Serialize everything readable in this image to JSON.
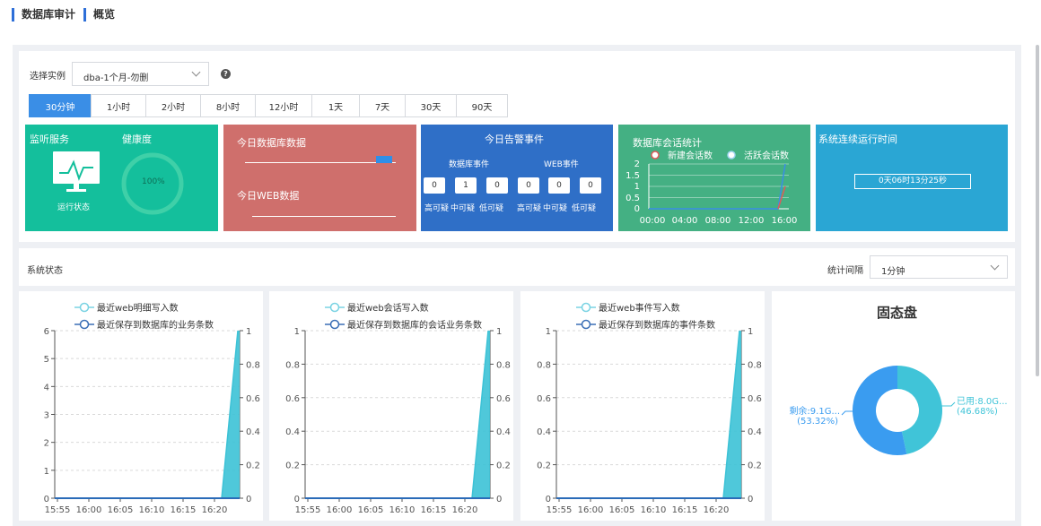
{
  "header": {
    "title": "数据库审计",
    "subtitle": "概览"
  },
  "filter": {
    "instance_label": "选择实例",
    "instance_value": "dba-1个月-勿删",
    "help_icon": "question-circle-icon",
    "time_tabs": [
      "30分钟",
      "1小时",
      "2小时",
      "8小时",
      "12小时",
      "1天",
      "7天",
      "30天",
      "90天"
    ],
    "active_tab": "30分钟"
  },
  "cards": {
    "monitor": {
      "title": "监听服务",
      "icon": "monitor-pulse-icon",
      "caption": "运行状态",
      "health_title": "健康度",
      "health_value": "100%",
      "health_level": 1.0,
      "color": "#14bf9c"
    },
    "today_data": {
      "title_db": "今日数据库数据",
      "title_web": "今日WEB数据",
      "color": "#cf6f6c"
    },
    "alerts": {
      "title": "今日告警事件",
      "db_label": "数据库事件",
      "web_label": "WEB事件",
      "db_counts": [
        "0",
        "1",
        "0"
      ],
      "web_counts": [
        "0",
        "0",
        "0"
      ],
      "db_levels": [
        "高可疑",
        "中可疑",
        "低可疑"
      ],
      "web_levels": [
        "高可疑",
        "中可疑",
        "低可疑"
      ],
      "color": "#2f6fc7"
    },
    "sessions": {
      "title": "数据库会话统计",
      "legend_new": "新建会话数",
      "legend_active": "活跃会话数",
      "yticks": [
        "2",
        "1.5",
        "1",
        "0.5",
        "0"
      ],
      "xticks": [
        "00:00",
        "04:00",
        "08:00",
        "12:00",
        "16:00"
      ],
      "color": "#44b083"
    },
    "uptime": {
      "title": "系统连续运行时间",
      "value": "0天06时13分25秒",
      "color": "#2aa6d4"
    }
  },
  "status": {
    "title": "系统状态",
    "interval_label": "统计间隔",
    "interval_value": "1分钟"
  },
  "charts": [
    {
      "legend_top": "最近web明细写入数",
      "legend_bottom": "最近保存到数据库的业务条数",
      "left_ticks": [
        "6",
        "5",
        "4",
        "3",
        "2",
        "1",
        "0"
      ],
      "right_ticks": [
        "1",
        "0.8",
        "0.6",
        "0.4",
        "0.2",
        "0"
      ],
      "xticks": [
        "15:55",
        "16:00",
        "16:05",
        "16:10",
        "16:15",
        "16:20"
      ]
    },
    {
      "legend_top": "最近web会话写入数",
      "legend_bottom": "最近保存到数据库的会话业务条数",
      "left_ticks": [
        "1",
        "0.8",
        "0.6",
        "0.4",
        "0.2",
        "0"
      ],
      "right_ticks": [
        "1",
        "0.8",
        "0.6",
        "0.4",
        "0.2",
        "0"
      ],
      "xticks": [
        "15:55",
        "16:00",
        "16:05",
        "16:10",
        "16:15",
        "16:20"
      ]
    },
    {
      "legend_top": "最近web事件写入数",
      "legend_bottom": "最近保存到数据库的事件条数",
      "left_ticks": [
        "1",
        "0.8",
        "0.6",
        "0.4",
        "0.2",
        "0"
      ],
      "right_ticks": [
        "1",
        "0.8",
        "0.6",
        "0.4",
        "0.2",
        "0"
      ],
      "xticks": [
        "15:55",
        "16:00",
        "16:05",
        "16:10",
        "16:15",
        "16:20"
      ]
    }
  ],
  "disk": {
    "title": "固态盘",
    "used_label": "已用:8.0G...",
    "used_pct": "(46.68%)",
    "free_label": "剩余:9.1G...",
    "free_pct": "(53.32%)",
    "used_value": 46.68,
    "free_value": 53.32,
    "used_color": "#40c4d8",
    "free_color": "#3a9cf0"
  }
}
